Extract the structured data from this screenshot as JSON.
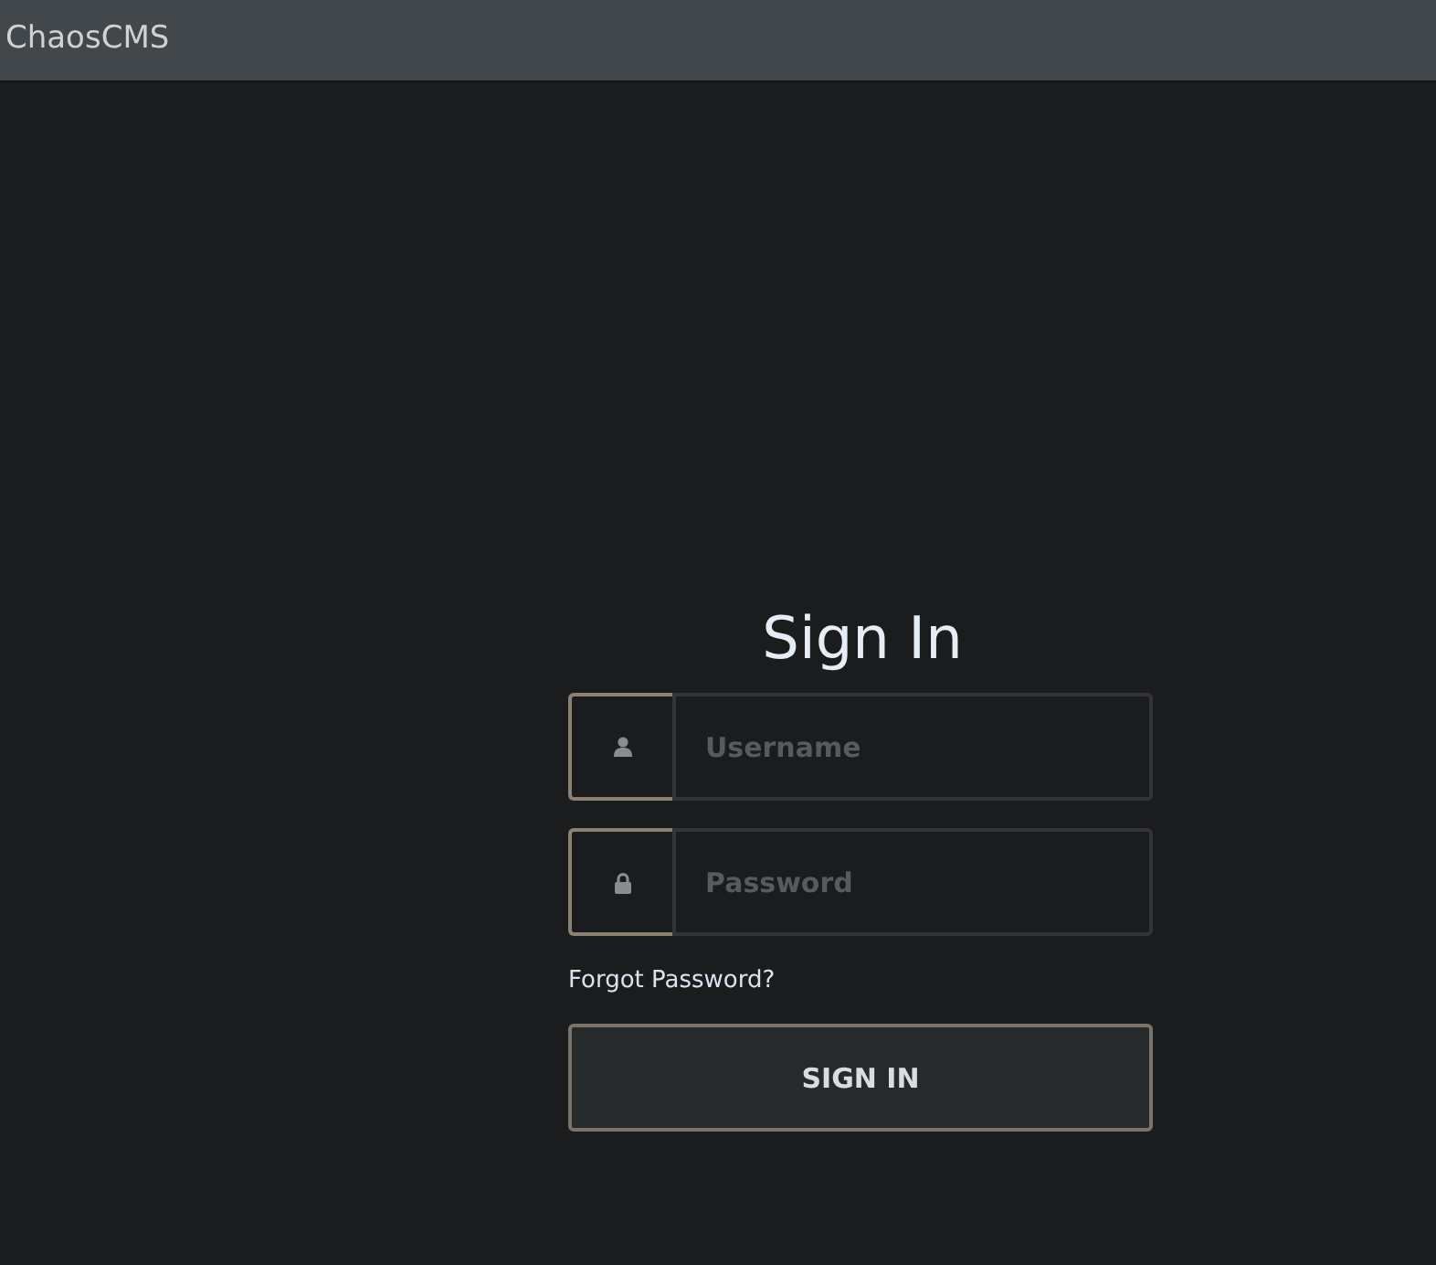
{
  "header": {
    "brand": "ChaosCMS"
  },
  "form": {
    "title": "Sign In",
    "fields": [
      {
        "kind": "username",
        "placeholder": "Username"
      },
      {
        "kind": "password",
        "placeholder": "Password"
      }
    ],
    "forgot_link": "Forgot Password?",
    "submit": "SIGN IN"
  }
}
